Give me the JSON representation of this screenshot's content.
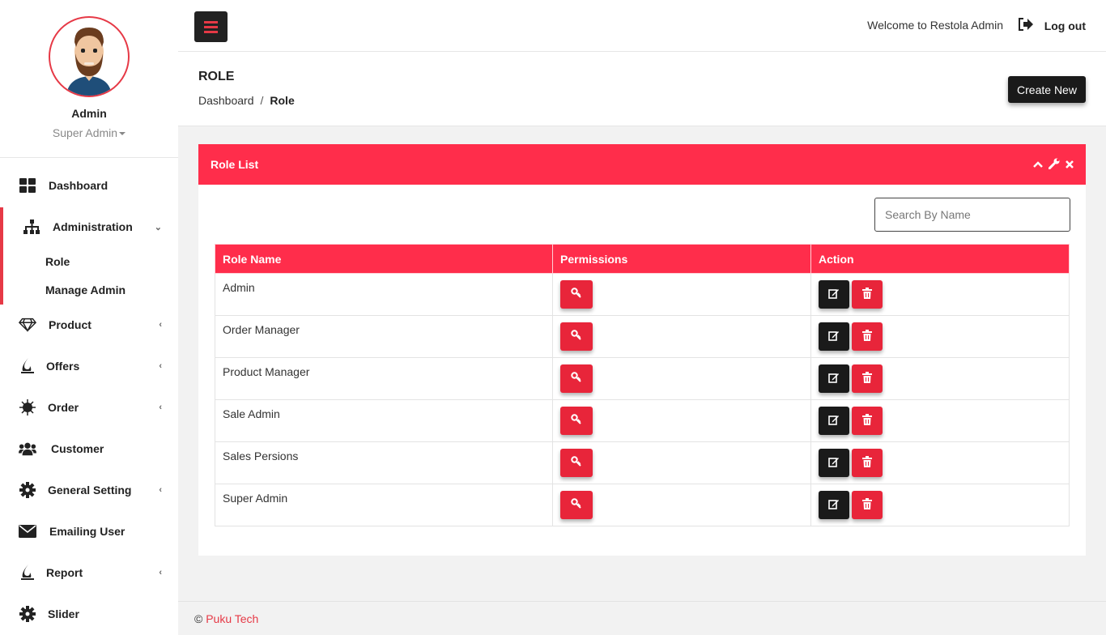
{
  "sidebar": {
    "profile": {
      "name": "Admin",
      "role": "Super Admin"
    },
    "items": [
      {
        "label": "Dashboard",
        "icon": "dashboard-icon"
      },
      {
        "label": "Administration",
        "icon": "sitemap-icon",
        "expanded": true,
        "children": [
          {
            "label": "Role"
          },
          {
            "label": "Manage Admin"
          }
        ]
      },
      {
        "label": "Product",
        "icon": "diamond-icon"
      },
      {
        "label": "Offers",
        "icon": "fire-icon"
      },
      {
        "label": "Order",
        "icon": "burst-icon"
      },
      {
        "label": "Customer",
        "icon": "users-icon"
      },
      {
        "label": "General Setting",
        "icon": "gear-icon"
      },
      {
        "label": "Emailing User",
        "icon": "envelope-icon"
      },
      {
        "label": "Report",
        "icon": "fire-icon"
      },
      {
        "label": "Slider",
        "icon": "gear-icon"
      }
    ]
  },
  "topbar": {
    "welcome": "Welcome to Restola Admin",
    "logout": "Log out"
  },
  "header": {
    "title": "ROLE",
    "breadcrumb": {
      "home": "Dashboard",
      "separator": "/",
      "current": "Role"
    },
    "create_button": "Create New"
  },
  "panel": {
    "title": "Role List",
    "search_placeholder": "Search By Name",
    "columns": [
      "Role Name",
      "Permissions",
      "Action"
    ],
    "rows": [
      {
        "name": "Admin"
      },
      {
        "name": "Order Manager"
      },
      {
        "name": "Product Manager"
      },
      {
        "name": "Sale Admin"
      },
      {
        "name": "Sales Persions"
      },
      {
        "name": "Super Admin"
      }
    ]
  },
  "footer": {
    "copyright": "©",
    "brand": "Puku Tech"
  },
  "colors": {
    "accent": "#ff2d4b",
    "dark": "#1a1a1a",
    "button_red": "#e8253a"
  }
}
